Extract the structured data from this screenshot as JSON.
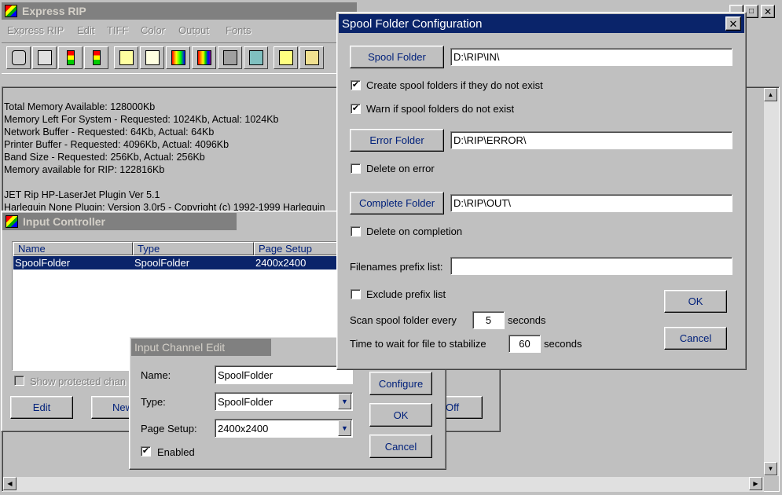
{
  "main": {
    "title": "Express RIP",
    "menu": [
      "Express RIP",
      "Edit",
      "TIFF",
      "Color",
      "Output",
      "Fonts"
    ],
    "log": [
      "Total Memory Available: 128000Kb",
      "Memory Left For System - Requested: 1024Kb, Actual: 1024Kb",
      "Network Buffer - Requested: 64Kb, Actual: 64Kb",
      "Printer Buffer - Requested: 4096Kb, Actual: 4096Kb",
      "Band Size - Requested: 256Kb, Actual: 256Kb",
      "Memory available for RIP: 122816Kb",
      "",
      "JET Rip HP-LaserJet Plugin Ver 5.1",
      "Harlequin None Plugin: Version 3.0r5 - Copyright (c) 1992-1999 Harlequin"
    ]
  },
  "input_controller": {
    "title": "Input Controller",
    "columns": [
      "Name",
      "Type",
      "Page Setup"
    ],
    "rows": [
      [
        "SpoolFolder",
        "SpoolFolder",
        "2400x2400"
      ]
    ],
    "show_protected": "Show protected chan",
    "edit_label": "Edit",
    "new_label": "New",
    "off_label": "Off"
  },
  "channel_edit": {
    "title": "Input Channel Edit",
    "name_label": "Name:",
    "name_value": "SpoolFolder",
    "type_label": "Type:",
    "type_value": "SpoolFolder",
    "page_setup_label": "Page Setup:",
    "page_setup_value": "2400x2400",
    "enabled_label": "Enabled",
    "configure_label": "Configure",
    "ok_label": "OK",
    "cancel_label": "Cancel"
  },
  "spool": {
    "title": "Spool Folder Configuration",
    "spool_folder_label": "Spool Folder",
    "spool_folder_value": "D:\\RIP\\IN\\",
    "create_label": "Create spool folders if they do not exist",
    "warn_label": "Warn if spool folders do not exist",
    "error_folder_label": "Error Folder",
    "error_folder_value": "D:\\RIP\\ERROR\\",
    "delete_on_error_label": "Delete on error",
    "complete_folder_label": "Complete Folder",
    "complete_folder_value": "D:\\RIP\\OUT\\",
    "delete_on_completion_label": "Delete on completion",
    "prefix_label": "Filenames prefix list:",
    "prefix_value": "",
    "exclude_label": "Exclude prefix list",
    "scan_label": "Scan spool folder every",
    "scan_value": "5",
    "scan_unit": "seconds",
    "wait_label": "Time to wait for file to stabilize",
    "wait_value": "60",
    "wait_unit": "seconds",
    "ok_label": "OK",
    "cancel_label": "Cancel"
  }
}
